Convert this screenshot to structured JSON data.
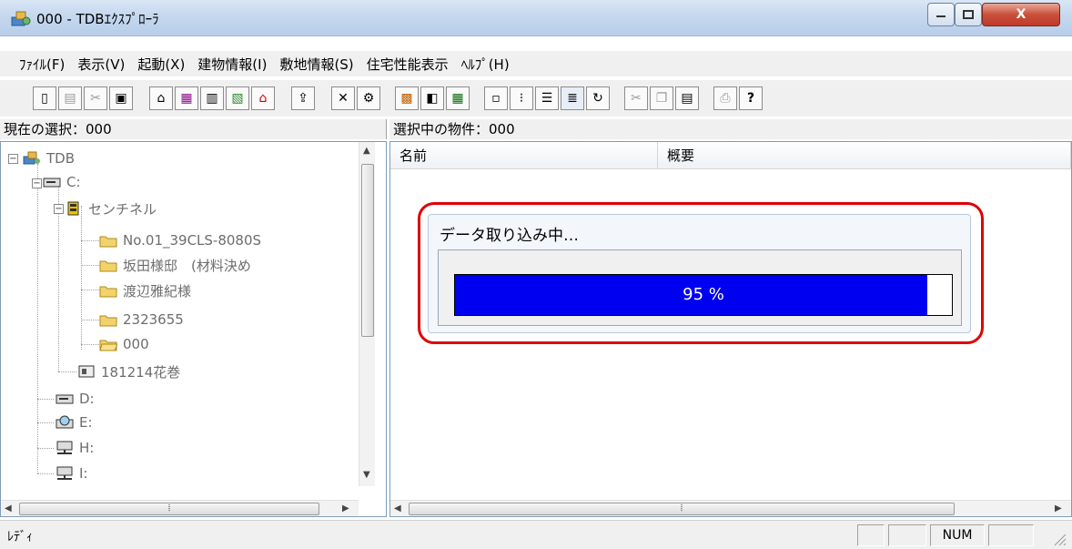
{
  "window": {
    "title": "000 - TDBｴｸｽﾌﾟﾛｰﾗ",
    "close_label": "X"
  },
  "menu": [
    "ﾌｧｲﾙ(F)",
    "表示(V)",
    "起動(X)",
    "建物情報(I)",
    "敷地情報(S)",
    "住宅性能表示",
    "ﾍﾙﾌﾟ(H)"
  ],
  "headers": {
    "current_selection": "現在の選択：000",
    "selected_property": "選択中の物件：000"
  },
  "tree": {
    "root": "TDB",
    "drive_c": "C:",
    "folder_sentinel": "センチネル",
    "items": [
      "No.01_39CLS-8080S",
      "坂田様邸　(材料決め",
      "渡辺雅紀様",
      "2323655",
      "000"
    ],
    "item_181214": "181214花巻",
    "drive_d": "D:",
    "drive_e": "E:",
    "drive_h": "H:",
    "drive_i": "I:"
  },
  "list": {
    "columns": [
      "名前",
      "概要"
    ]
  },
  "progress": {
    "title": "データ取り込み中…",
    "percent": 0.95,
    "label": "95 %"
  },
  "status": {
    "text": "ﾚﾃﾞｨ",
    "num": "NUM"
  },
  "colors": {
    "progress_fill": "#0000f0",
    "highlight": "#e00000"
  }
}
